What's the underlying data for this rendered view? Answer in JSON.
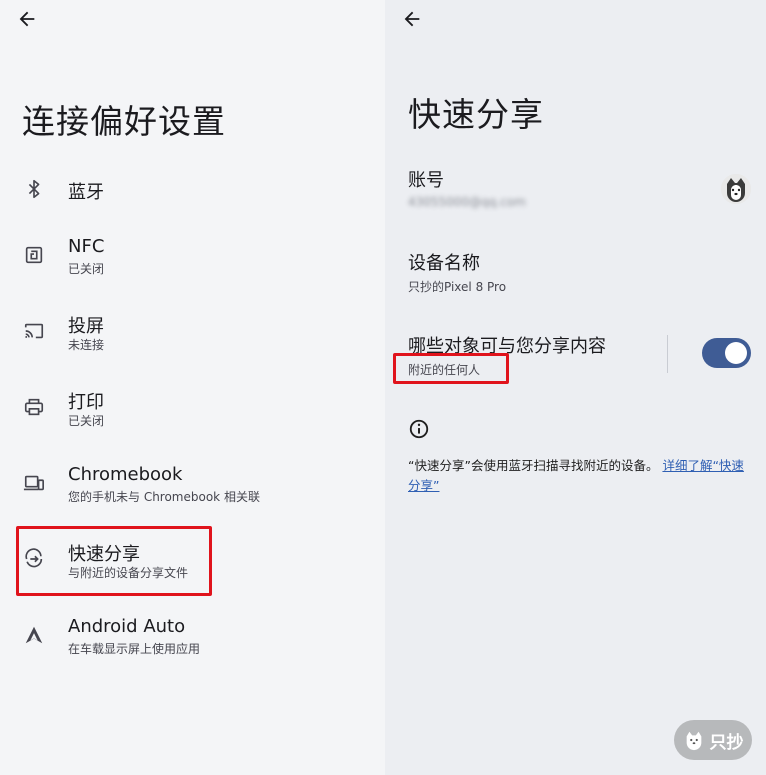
{
  "left": {
    "title": "连接偏好设置",
    "items": [
      {
        "title": "蓝牙",
        "subtitle": "",
        "icon": "bluetooth-icon"
      },
      {
        "title": "NFC",
        "subtitle": "已关闭",
        "icon": "nfc-icon"
      },
      {
        "title": "投屏",
        "subtitle": "未连接",
        "icon": "cast-icon"
      },
      {
        "title": "打印",
        "subtitle": "已关闭",
        "icon": "print-icon"
      },
      {
        "title": "Chromebook",
        "subtitle": "您的手机未与 Chromebook 相关联",
        "icon": "chromebook-icon"
      },
      {
        "title": "快速分享",
        "subtitle": "与附近的设备分享文件",
        "icon": "quick-share-icon"
      },
      {
        "title": "Android Auto",
        "subtitle": "在车载显示屏上使用应用",
        "icon": "android-auto-icon"
      }
    ]
  },
  "right": {
    "title": "快速分享",
    "account": {
      "label": "账号",
      "value": "43055000@qq.com"
    },
    "device": {
      "label": "设备名称",
      "value": "只抄的Pixel 8 Pro"
    },
    "visibility": {
      "label": "哪些对象可与您分享内容",
      "value": "附近的任何人",
      "enabled": true
    },
    "info": {
      "text": "“快速分享”会使用蓝牙扫描寻找附近的设备。",
      "link": "详细了解“快速分享”"
    }
  },
  "watermark": {
    "text": "只抄"
  },
  "colors": {
    "accent": "#3f5c95",
    "highlight": "#e0131c",
    "link": "#2f5fb3"
  }
}
